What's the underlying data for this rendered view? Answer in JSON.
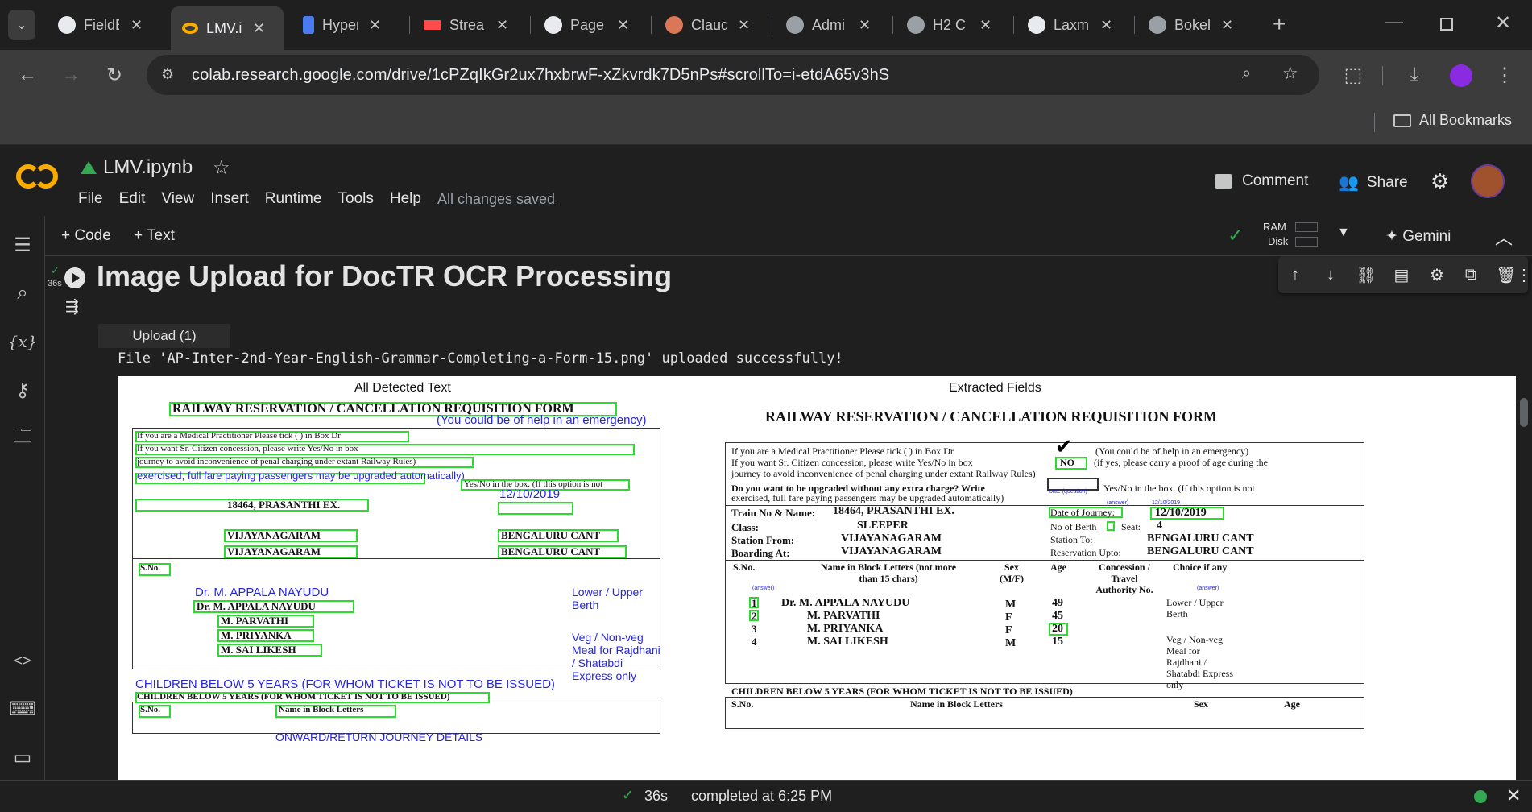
{
  "browser": {
    "tabs": [
      {
        "label": "FieldE",
        "icon": "github-icon",
        "active": false
      },
      {
        "label": "LMV.i",
        "icon": "colab-icon",
        "active": true
      },
      {
        "label": "Hyper",
        "icon": "hyperlink-icon",
        "active": false
      },
      {
        "label": "Strear",
        "icon": "streamlit-icon",
        "active": false
      },
      {
        "label": "Page",
        "icon": "github-icon",
        "active": false
      },
      {
        "label": "Claud",
        "icon": "claude-icon",
        "active": false
      },
      {
        "label": "Admi",
        "icon": "globe-icon",
        "active": false
      },
      {
        "label": "H2 C",
        "icon": "globe-icon",
        "active": false
      },
      {
        "label": "Laxm",
        "icon": "github-icon",
        "active": false
      },
      {
        "label": "Bokel",
        "icon": "globe-icon",
        "active": false
      }
    ],
    "url": "colab.research.google.com/drive/1cPZqIkGr2ux7hxbrwF-xZkvrdk7D5nPs#scrollTo=i-etdA65v3hS",
    "bookmarks_label": "All Bookmarks"
  },
  "colab": {
    "notebook_name": "LMV.ipynb",
    "menu": [
      "File",
      "Edit",
      "View",
      "Insert",
      "Runtime",
      "Tools",
      "Help"
    ],
    "save_status": "All changes saved",
    "comment_label": "Comment",
    "share_label": "Share",
    "add_code_label": "Code",
    "add_text_label": "Text",
    "ram_label": "RAM",
    "disk_label": "Disk",
    "gemini_label": "Gemini"
  },
  "cell": {
    "exec_time": "36s",
    "heading": "Image Upload for DocTR OCR Processing",
    "upload_button": "Upload (1)",
    "output_message": "File 'AP-Inter-2nd-Year-English-Grammar-Completing-a-Form-15.png' uploaded successfully!",
    "left_panel_title": "All Detected Text",
    "right_panel_title": "Extracted Fields"
  },
  "form": {
    "title": "RAILWAY RESERVATION / CANCELLATION REQUISITION FORM",
    "line1": "If you are a Medical Practitioner  Please tick ( ) in Box  Dr",
    "line1b": "(You could be of help in an emergency)",
    "line2": "If you want Sr. Citizen concession, please write Yes/No in box",
    "line2b": "NO",
    "line2c": "(if yes, please carry a proof of age during the",
    "line2d": "journey to avoid inconvenience of penal charging under extant Railway Rules)",
    "line3": "Do you want to be upgraded without any extra charge? Write",
    "line3b": "Yes/No in the box. (If this option is not",
    "line3c": "exercised, full fare paying passengers may be upgraded automatically)",
    "train_label": "Train No & Name:",
    "train_value": "18464, PRASANTHI EX.",
    "doj_label": "Date of Journey:",
    "doj_value": "12/10/2019",
    "class_label": "Class:",
    "class_value": "SLEEPER",
    "berth_label": "No of Berth",
    "seat_label": "Seat:",
    "seat_value": "4",
    "from_label": "Station From:",
    "from_value": "VIJAYANAGARAM",
    "to_label": "Station To:",
    "to_value": "BENGALURU CANT",
    "boarding_label": "Boarding At:",
    "boarding_value": "VIJAYANAGARAM",
    "upto_label": "Reservation Upto:",
    "upto_value": "BENGALURU CANT",
    "headers": [
      "S.No.",
      "Name in Block Letters (not more than 15 chars)",
      "Sex (M/F)",
      "Age",
      "Concession / Travel Authority No.",
      "Choice if any"
    ],
    "rows": [
      {
        "no": "1",
        "name": "Dr. M. APPALA NAYUDU",
        "sex": "M",
        "age": "49"
      },
      {
        "no": "2",
        "name": "M. PARVATHI",
        "sex": "F",
        "age": "45"
      },
      {
        "no": "3",
        "name": "M. PRIYANKA",
        "sex": "F",
        "age": "20"
      },
      {
        "no": "4",
        "name": "M. SAI LIKESH",
        "sex": "M",
        "age": "15"
      }
    ],
    "choice1": "Lower / Upper Berth",
    "choice2": "Veg / Non-veg Meal for Rajdhani / Shatabdi Express only",
    "children_line": "CHILDREN BELOW 5 YEARS (FOR WHOM TICKET IS NOT TO BE ISSUED)",
    "children_headers": [
      "S.No.",
      "Name in Block Letters",
      "Sex",
      "Age"
    ],
    "onward": "ONWARD/RETURN JOURNEY DETAILS",
    "answer_tag": "(answer)",
    "date_question_tag": "Date (question)"
  },
  "status": {
    "check_time": "36s",
    "completed": "completed at 6:25 PM"
  },
  "colors": {
    "detect_box": "#2cdc2c",
    "detect_text": "#2525e0",
    "colab_orange": "#f9ab00"
  }
}
